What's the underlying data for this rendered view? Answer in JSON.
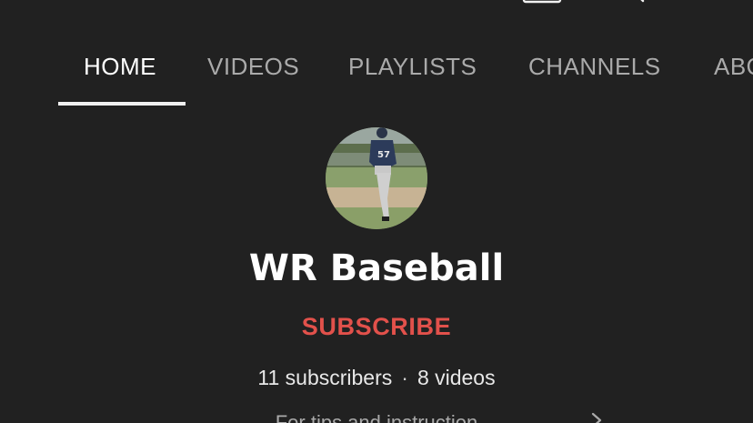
{
  "header": {
    "title": "WR Baseball"
  },
  "tabs": [
    {
      "label": "HOME",
      "active": true
    },
    {
      "label": "VIDEOS"
    },
    {
      "label": "PLAYLISTS"
    },
    {
      "label": "CHANNELS"
    },
    {
      "label": "ABOUT"
    }
  ],
  "channel": {
    "name": "WR Baseball",
    "subscribe_label": "SUBSCRIBE",
    "subscribers": "11 subscribers",
    "videos": "8 videos",
    "description": "For tips and instruction"
  },
  "colors": {
    "background": "#212121",
    "subscribe": "#e2514b",
    "tab_inactive": "#aaaaaa",
    "tab_active": "#ffffff"
  },
  "icons": [
    "back-arrow-icon",
    "cast-icon",
    "search-icon",
    "chevron-right-icon"
  ]
}
